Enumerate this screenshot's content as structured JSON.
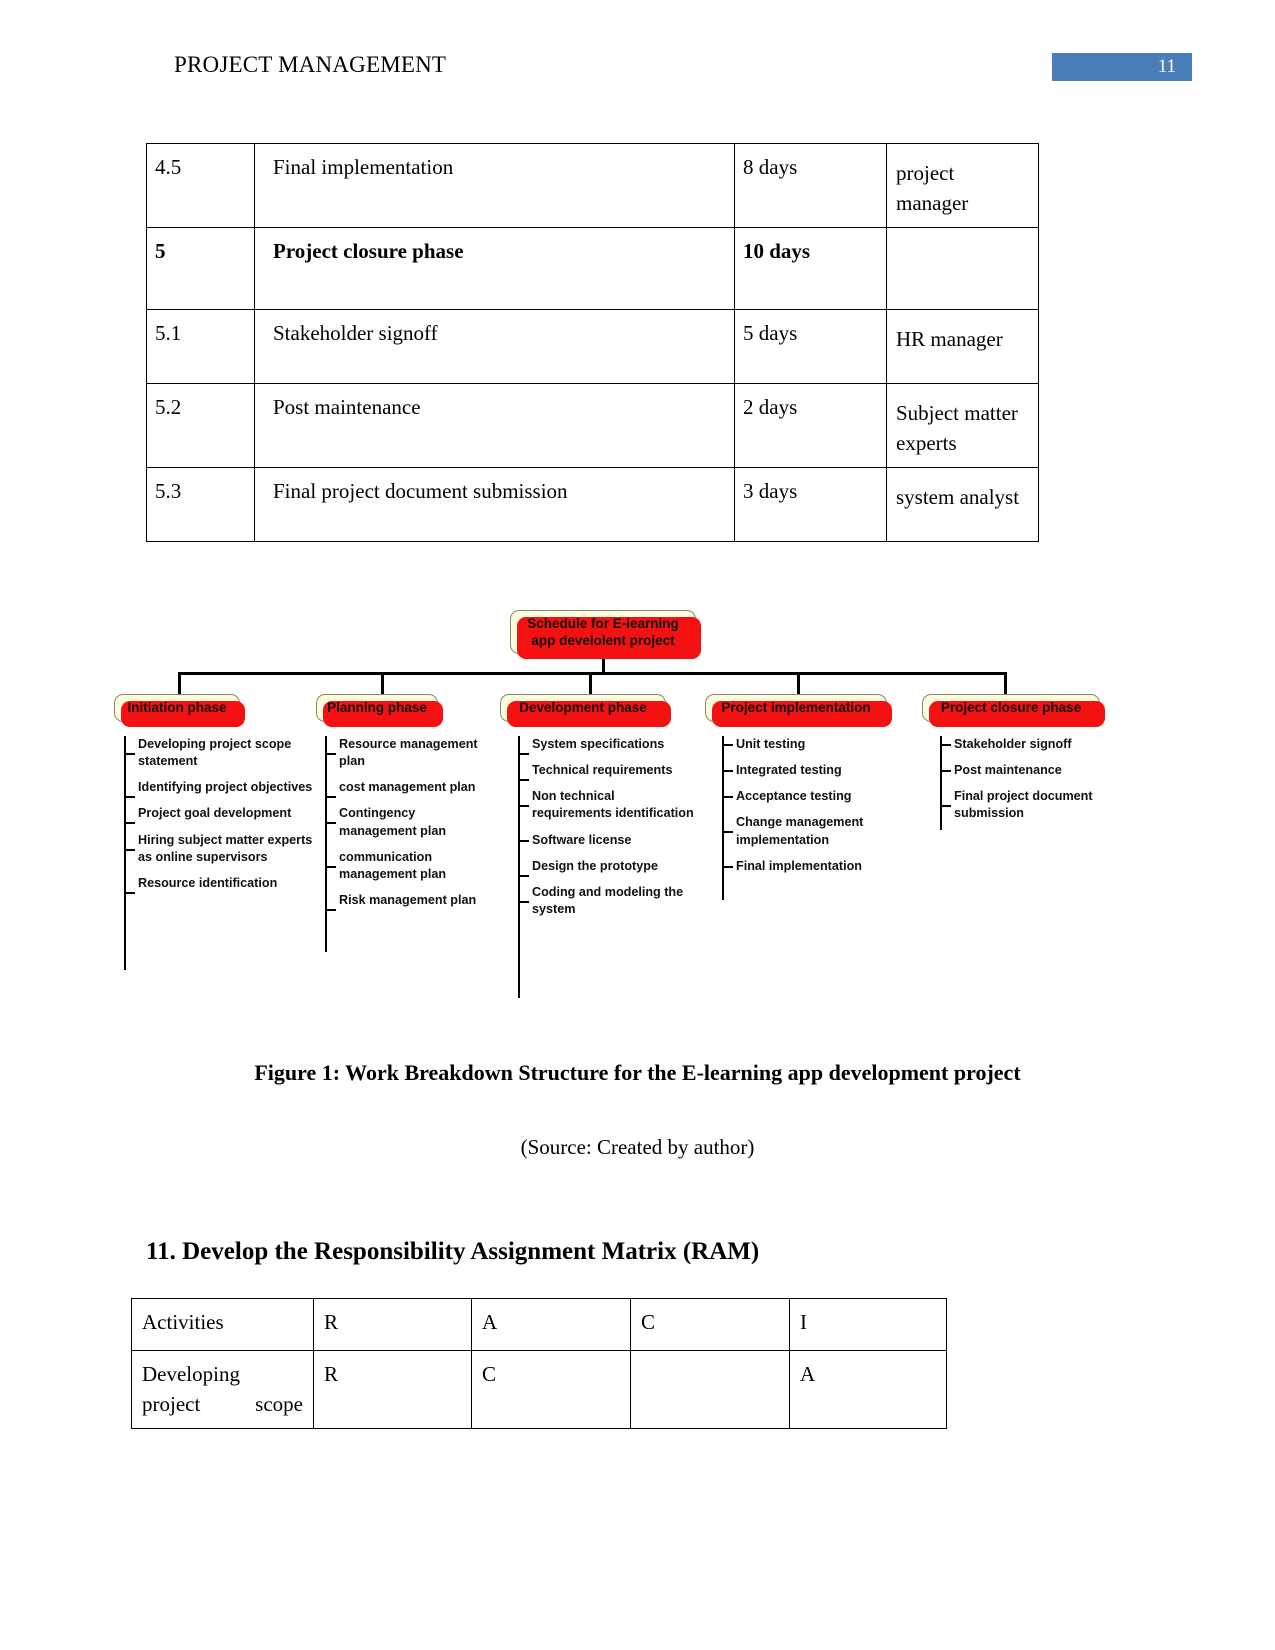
{
  "header": {
    "title": "PROJECT MANAGEMENT",
    "page_number": "11",
    "badge_color": "#4a7ebb"
  },
  "schedule_table": {
    "rows": [
      {
        "id": "4.5",
        "task": "Final implementation",
        "duration": "8 days",
        "resource": "project manager",
        "bold": false
      },
      {
        "id": "5",
        "task": "Project closure phase",
        "duration": "10 days",
        "resource": "",
        "bold": true
      },
      {
        "id": "5.1",
        "task": "Stakeholder signoff",
        "duration": "5 days",
        "resource": "HR manager",
        "bold": false
      },
      {
        "id": "5.2",
        "task": "Post maintenance",
        "duration": "2 days",
        "resource": "Subject  matter experts",
        "bold": false
      },
      {
        "id": "5.3",
        "task": "Final project document submission",
        "duration": "3 days",
        "resource": "system analyst",
        "bold": false
      }
    ]
  },
  "wbs": {
    "root": "Schedule for E-learning app develolent project",
    "node_fill": "#fbfbdd",
    "node_shadow": "#f41111",
    "branches": [
      {
        "title": "Initiation phase",
        "leaves": [
          "Developing project scope statement",
          "Identifying project objectives",
          "Project goal development",
          "Hiring subject matter experts as online supervisors",
          "Resource identification"
        ]
      },
      {
        "title": "Planning phase",
        "leaves": [
          "Resource management plan",
          "cost management plan",
          "Contingency management plan",
          "communication management plan",
          "Risk management plan"
        ]
      },
      {
        "title": "Development phase",
        "leaves": [
          "System specifications",
          "Technical requirements",
          "Non technical requirements identification",
          "Software license",
          "Design the prototype",
          "Coding and modeling the system"
        ]
      },
      {
        "title": "Project implementation",
        "leaves": [
          "Unit testing",
          "Integrated testing",
          "Acceptance testing",
          "Change management implementation",
          "Final implementation"
        ]
      },
      {
        "title": "Project closure phase",
        "leaves": [
          "Stakeholder signoff",
          "Post maintenance",
          "Final project document submission"
        ]
      }
    ]
  },
  "figure_caption": "Figure 1: Work Breakdown Structure for the E-learning app development project",
  "source_caption": "(Source: Created by author)",
  "section_heading": "11. Develop the Responsibility Assignment Matrix (RAM)",
  "ram_table": {
    "headers": [
      "Activities",
      "R",
      "A",
      "C",
      "I"
    ],
    "rows": [
      {
        "activity": "Developing project scope",
        "r": "R",
        "a": "C",
        "c": "",
        "i": "A"
      }
    ]
  }
}
